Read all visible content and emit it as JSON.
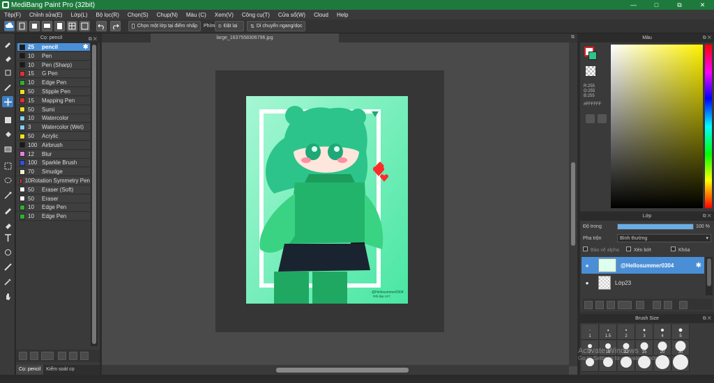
{
  "window": {
    "title": "MediBang Paint Pro (32bit)",
    "controls": [
      "—",
      "□",
      "⧉",
      "✕"
    ]
  },
  "menu": [
    "Tệp(F)",
    "Chỉnh sửa(E)",
    "Lớp(L)",
    "Bộ lọc(R)",
    "Chọn(S)",
    "Chụp(N)",
    "Màu (C)",
    "Xem(V)",
    "Công cụ(T)",
    "Cửa sổ(W)",
    "Cloud",
    "Help"
  ],
  "toolbar": {
    "select_layer_checkbox": "Chọn một lớp tại điểm nhấp",
    "key_label": "Phím",
    "reset_label": "Đặt lại",
    "flip_label": "Di chuyển ngang/dọc"
  },
  "brush_panel": {
    "title": "Cọ: pencil",
    "brushes": [
      {
        "size": "25",
        "name": "pencil",
        "color": "#1a1a1a",
        "selected": true
      },
      {
        "size": "10",
        "name": "Pen",
        "color": "#1a1a1a"
      },
      {
        "size": "10",
        "name": "Pen (Sharp)",
        "color": "#1a1a1a"
      },
      {
        "size": "15",
        "name": "G Pen",
        "color": "#e03030"
      },
      {
        "size": "10",
        "name": "Edge Pen",
        "color": "#2fb02f"
      },
      {
        "size": "50",
        "name": "Stipple Pen",
        "color": "#f2e020"
      },
      {
        "size": "15",
        "name": "Mapping Pen",
        "color": "#e03030"
      },
      {
        "size": "50",
        "name": "Sumi",
        "color": "#f2e020"
      },
      {
        "size": "10",
        "name": "Watercolor",
        "color": "#7fd0f0"
      },
      {
        "size": "3",
        "name": "Watercolor (Wet)",
        "color": "#7fd0f0"
      },
      {
        "size": "50",
        "name": "Acrylic",
        "color": "#f2e020"
      },
      {
        "size": "100",
        "name": "Airbrush",
        "color": "#1a1a1a"
      },
      {
        "size": "12",
        "name": "Blur",
        "color": "#e080e0"
      },
      {
        "size": "100",
        "name": "Sparkle Brush",
        "color": "#3050e0"
      },
      {
        "size": "70",
        "name": "Smudge",
        "color": "#f0f0d0"
      },
      {
        "size": "10",
        "name": "Rotation Symmetry Pen",
        "color": "#e03030"
      },
      {
        "size": "50",
        "name": "Eraser (Soft)",
        "color": "#ffffff"
      },
      {
        "size": "50",
        "name": "Eraser",
        "color": "#ffffff"
      },
      {
        "size": "10",
        "name": "Edge Pen",
        "color": "#2fb02f"
      },
      {
        "size": "10",
        "name": "Edge Pen",
        "color": "#2fb02f"
      }
    ],
    "tabs": [
      "Cọ: pencil",
      "Kiểm soát cọ"
    ]
  },
  "canvas": {
    "tab_title": "large_1637558306796.jpg",
    "artwork_signature": "@Hellosummer0304",
    "artwork_signature_sub": "Rất đẹp 24?"
  },
  "color_panel": {
    "title": "Màu",
    "rgb": [
      "R:255",
      "G:255",
      "B:255"
    ],
    "hex": "#FFFFFF"
  },
  "layer_panel": {
    "title": "Lớp",
    "opacity_label": "Độ trong",
    "opacity_value": "100 %",
    "opacity": 1.0,
    "blend_label": "Pha trộn",
    "blend_value": "Bình thường",
    "protect_alpha": "Bảo vệ alpha",
    "clipping": "Xén bớt",
    "lock": "Khóa",
    "layers": [
      {
        "name": "@Hellosummer0304",
        "selected": true
      },
      {
        "name": "Lớp23",
        "selected": false
      }
    ]
  },
  "brush_size_panel": {
    "title": "Brush Size",
    "sizes": [
      "1",
      "1.5",
      "2",
      "3",
      "4",
      "5",
      "7",
      "10",
      "12",
      "15",
      "20",
      "30"
    ]
  },
  "watermark": {
    "line1": "Activate Windows",
    "line2": "Go to Settings to activate Windows."
  },
  "colors": {
    "title_green": "#1d7a3c",
    "accent_blue": "#4a8fd6",
    "art_mint": "#6ef0b8",
    "hair_green": "#2cc48a"
  }
}
